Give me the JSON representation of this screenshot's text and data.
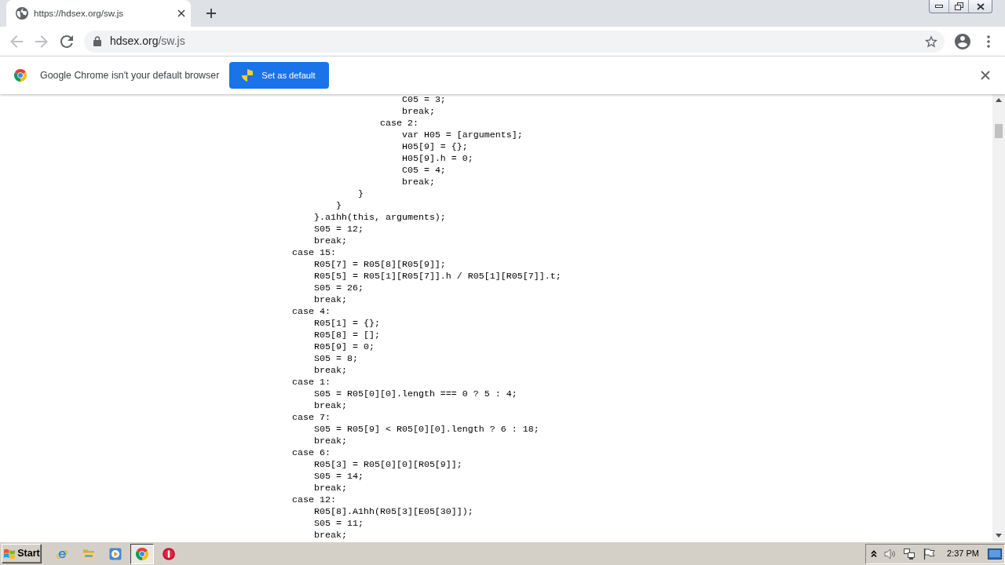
{
  "tabs": [
    {
      "title": "https://hdsex.org/sw.js",
      "selected": true
    }
  ],
  "nav_buttons": [
    {
      "kind": "back",
      "disabled": true
    },
    {
      "kind": "forward",
      "disabled": true
    },
    {
      "kind": "reload",
      "disabled": false
    }
  ],
  "address": {
    "host": "hdsex.org",
    "path": "/sw.js"
  },
  "infobar": {
    "message": "Google Chrome isn't your default browser",
    "button": "Set as default"
  },
  "code_lines": [
    "                    C05 = 3;",
    "                    break;",
    "                case 2:",
    "                    var H05 = [arguments];",
    "                    H05[9] = {};",
    "                    H05[9].h = 0;",
    "                    C05 = 4;",
    "                    break;",
    "            }",
    "        }",
    "    }.a1hh(this, arguments);",
    "    S05 = 12;",
    "    break;",
    "case 15:",
    "    R05[7] = R05[8][R05[9]];",
    "    R05[5] = R05[1][R05[7]].h / R05[1][R05[7]].t;",
    "    S05 = 26;",
    "    break;",
    "case 4:",
    "    R05[1] = {};",
    "    R05[8] = [];",
    "    R05[9] = 0;",
    "    S05 = 8;",
    "    break;",
    "case 1:",
    "    S05 = R05[0][0].length === 0 ? 5 : 4;",
    "    break;",
    "case 7:",
    "    S05 = R05[9] < R05[0][0].length ? 6 : 18;",
    "    break;",
    "case 6:",
    "    R05[3] = R05[0][0][R05[9]];",
    "    S05 = 14;",
    "    break;",
    "case 12:",
    "    R05[8].A1hh(R05[3][E05[30]]);",
    "    S05 = 11;",
    "    break;"
  ],
  "taskbar": {
    "start": "Start",
    "apps": [
      {
        "kind": "ie",
        "selected": false
      },
      {
        "kind": "folder",
        "selected": false
      },
      {
        "kind": "media",
        "selected": false
      },
      {
        "kind": "chrome",
        "selected": true
      },
      {
        "kind": "stop",
        "selected": false
      }
    ],
    "clock": "2:37 PM"
  }
}
